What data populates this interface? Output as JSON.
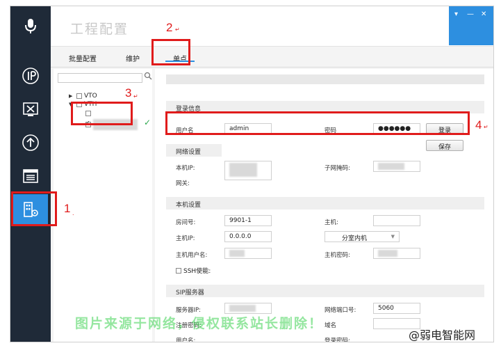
{
  "titlebar": {
    "title": "工程配置"
  },
  "window_controls": {
    "menu": "▾",
    "minimize": "—",
    "close": "✕"
  },
  "tabs": [
    {
      "label": "批量配置"
    },
    {
      "label": "维护"
    },
    {
      "label": "单点",
      "active": true
    }
  ],
  "tree": {
    "nodes": [
      {
        "label": "VTO"
      },
      {
        "label": "VTH"
      }
    ]
  },
  "form": {
    "login_section": "登录信息",
    "username_label": "用户名",
    "username_value": "admin",
    "password_label": "密码",
    "password_value": "●●●●●●",
    "login_button": "登录",
    "save_button": "保存",
    "network_section": "网络设置",
    "local_ip_label": "本机IP:",
    "subnet_mask_label": "子网掩码:",
    "gateway_label": "网关:",
    "local_section": "本机设置",
    "room_no_label": "房间号:",
    "room_no_value": "9901-1",
    "host_label": "主机:",
    "host_ip_label": "主机IP:",
    "host_ip_value": "0.0.0.0",
    "device_type_value": "分室内机",
    "host_user_label": "主机用户名:",
    "host_password_label": "主机密码:",
    "ssh_label": "SSH使能:",
    "sip_section": "SIP服务器",
    "server_ip_label": "服务器IP:",
    "network_port_label": "网络端口号:",
    "network_port_value": "5060",
    "register_password_label": "注册密码:",
    "domain_label": "域名",
    "sip_user_label": "用户名:",
    "login_password_label": "登录密码:"
  },
  "annotations": {
    "n1": "1",
    "n2": "2",
    "n3": "3",
    "n4": "4",
    "mark": "↵",
    "dot": "."
  },
  "watermarks": {
    "center": "图片来源于网络，侵权联系站长删除！",
    "corner": "@弱电智能网"
  },
  "colors": {
    "rail": "#1f2a38",
    "accent": "#2d8fe0",
    "annotation": "#e01b1b",
    "online": "#2fa84f"
  }
}
